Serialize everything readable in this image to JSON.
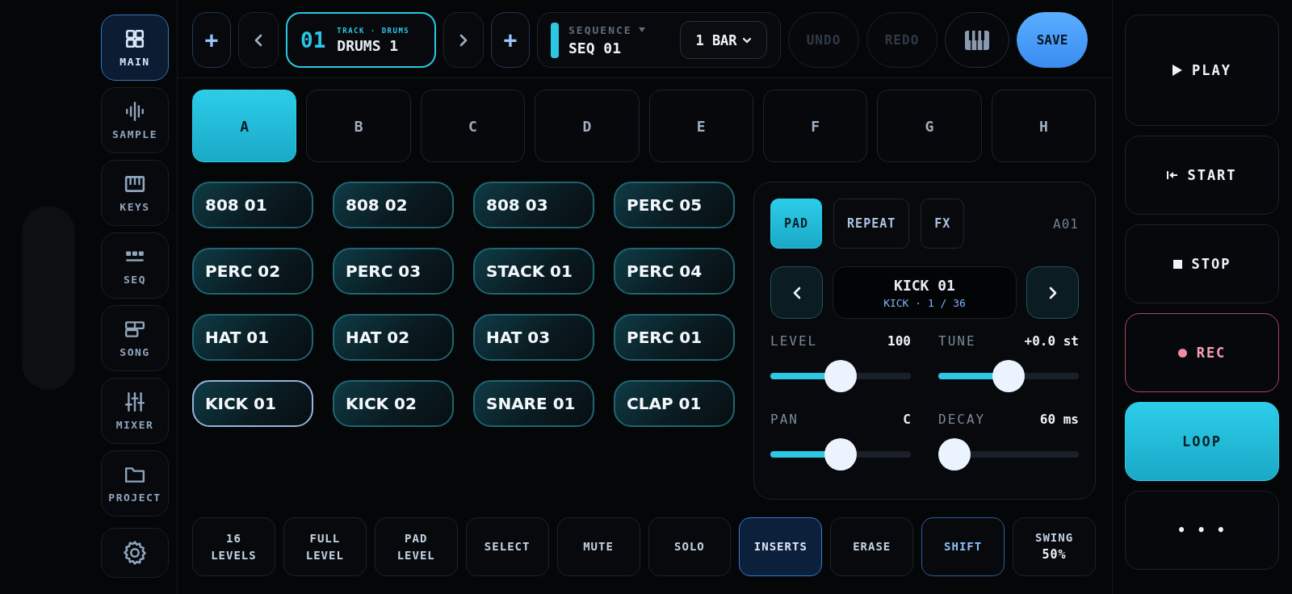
{
  "sidebar": {
    "items": [
      {
        "label": "MAIN",
        "selected": true
      },
      {
        "label": "SAMPLE",
        "selected": false
      },
      {
        "label": "KEYS",
        "selected": false
      },
      {
        "label": "SEQ",
        "selected": false
      },
      {
        "label": "SONG",
        "selected": false
      },
      {
        "label": "MIXER",
        "selected": false
      },
      {
        "label": "PROJECT",
        "selected": false
      }
    ]
  },
  "top_bar": {
    "add_buttons": [
      {
        "label": "+"
      },
      {
        "label": "+"
      }
    ],
    "track": {
      "number": "01",
      "caption": "TRACK · DRUMS",
      "name": "DRUMS 1"
    },
    "sequence": {
      "label": "SEQUENCE",
      "name": "SEQ 01",
      "length": "1 BAR"
    },
    "undo": {
      "label": "UNDO",
      "disabled": true
    },
    "redo": {
      "label": "REDO",
      "disabled": true
    },
    "save": {
      "label": "SAVE"
    }
  },
  "banks": [
    {
      "label": "A",
      "selected": true
    },
    {
      "label": "B",
      "selected": false
    },
    {
      "label": "C",
      "selected": false
    },
    {
      "label": "D",
      "selected": false
    },
    {
      "label": "E",
      "selected": false
    },
    {
      "label": "F",
      "selected": false
    },
    {
      "label": "G",
      "selected": false
    },
    {
      "label": "H",
      "selected": false
    }
  ],
  "pads": [
    {
      "label": "808 01",
      "selected": false
    },
    {
      "label": "808 02",
      "selected": false
    },
    {
      "label": "808 03",
      "selected": false
    },
    {
      "label": "PERC 05",
      "selected": false
    },
    {
      "label": "PERC 02",
      "selected": false
    },
    {
      "label": "PERC 03",
      "selected": false
    },
    {
      "label": "STACK 01",
      "selected": false
    },
    {
      "label": "PERC 04",
      "selected": false
    },
    {
      "label": "HAT 01",
      "selected": false
    },
    {
      "label": "HAT 02",
      "selected": false
    },
    {
      "label": "HAT 03",
      "selected": false
    },
    {
      "label": "PERC 01",
      "selected": false
    },
    {
      "label": "KICK 01",
      "selected": true
    },
    {
      "label": "KICK 02",
      "selected": false
    },
    {
      "label": "SNARE 01",
      "selected": false
    },
    {
      "label": "CLAP 01",
      "selected": false
    }
  ],
  "pad_panel": {
    "tabs": [
      {
        "label": "PAD",
        "selected": true
      },
      {
        "label": "REPEAT",
        "selected": false
      },
      {
        "label": "FX",
        "selected": false
      }
    ],
    "pad_id": "A01",
    "sample": {
      "name": "KICK 01",
      "info": "KICK · 1 / 36"
    },
    "params": [
      {
        "label": "LEVEL",
        "value": "100",
        "level": 0.5
      },
      {
        "label": "TUNE",
        "value": "+0.0 st",
        "level": 0.5
      },
      {
        "label": "PAN",
        "value": "C",
        "level": 0.5
      },
      {
        "label": "DECAY",
        "value": "60 ms",
        "level": 0.0
      }
    ]
  },
  "bottom_bar": [
    {
      "label": "16\nLEVELS",
      "selected": false,
      "armed": false
    },
    {
      "label": "FULL\nLEVEL",
      "selected": false,
      "armed": false
    },
    {
      "label": "PAD\nLEVEL",
      "selected": false,
      "armed": false
    },
    {
      "label": "SELECT",
      "selected": false,
      "armed": false
    },
    {
      "label": "MUTE",
      "selected": false,
      "armed": false
    },
    {
      "label": "SOLO",
      "selected": false,
      "armed": false
    },
    {
      "label": "INSERTS",
      "selected": true,
      "armed": false
    },
    {
      "label": "ERASE",
      "selected": false,
      "armed": false
    },
    {
      "label": "SHIFT",
      "selected": false,
      "armed": true
    },
    {
      "label": "SWING",
      "value": "50%",
      "selected": false,
      "armed": false
    }
  ],
  "transport": [
    {
      "kind": "play",
      "label": "PLAY",
      "on": false
    },
    {
      "kind": "start",
      "label": "START",
      "on": false
    },
    {
      "kind": "stop",
      "label": "STOP",
      "on": false
    },
    {
      "kind": "record",
      "label": "REC",
      "on": false
    },
    {
      "kind": "loop",
      "label": "LOOP",
      "on": true
    },
    {
      "kind": "more",
      "label": "• • •",
      "on": false
    }
  ]
}
